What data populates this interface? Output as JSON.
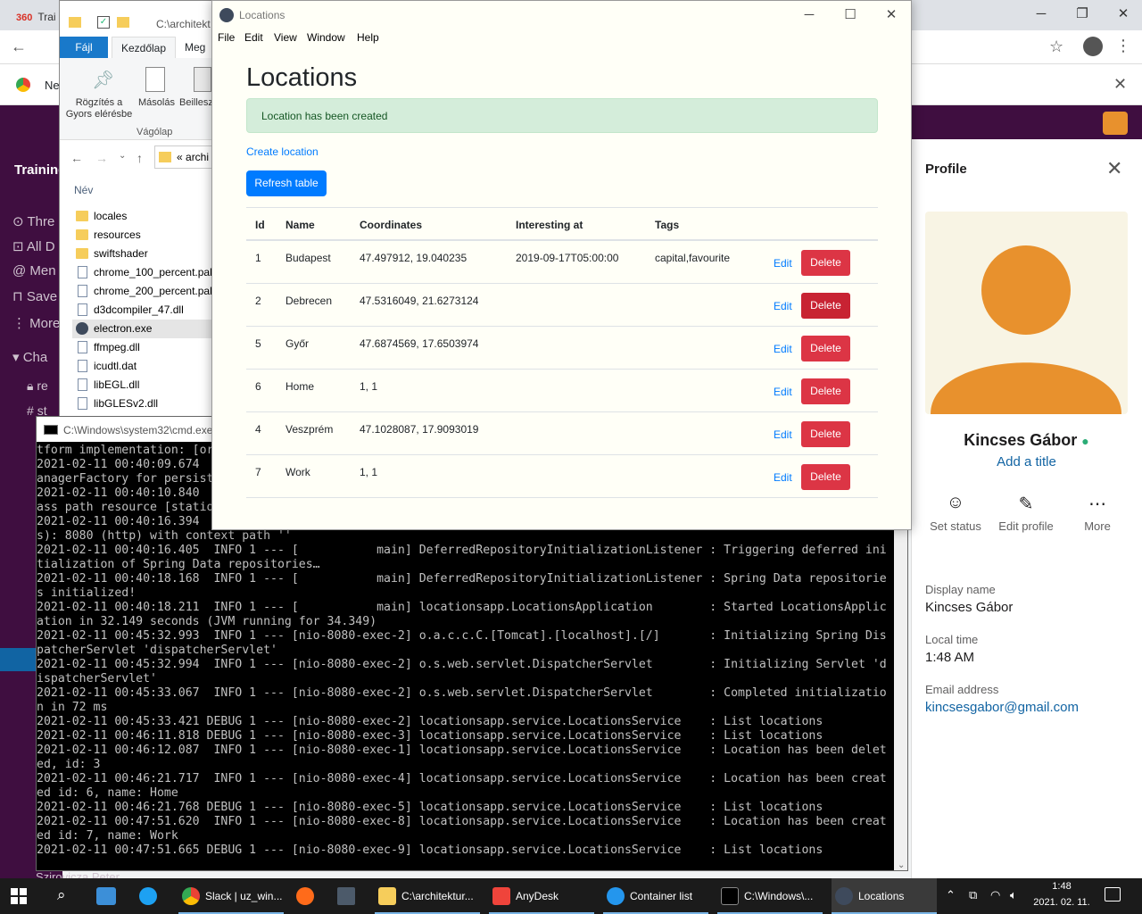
{
  "chrome": {
    "tab_title": "Trai",
    "tab_logo": "360",
    "bookmark_text": "Ne"
  },
  "slack": {
    "workspace": "Training",
    "nav": [
      "Thre",
      "All D",
      "Men",
      "Save",
      "More",
      "Cha"
    ],
    "channel_prefix_1": "re",
    "channel_prefix_2": "st",
    "bottom_user": "Szirovicza Peter",
    "profile": {
      "title": "Profile",
      "name": "Kincses Gábor",
      "add_title": "Add a title",
      "actions": [
        "Set status",
        "Edit profile",
        "More"
      ],
      "display_name_label": "Display name",
      "display_name": "Kincses Gábor",
      "local_time_label": "Local time",
      "local_time": "1:48 AM",
      "email_label": "Email address",
      "email": "kincsesgabor@gmail.com"
    }
  },
  "explorer": {
    "title": "C:\\architekt",
    "tabs": {
      "file": "Fájl",
      "home": "Kezdőlap",
      "share": "Meg"
    },
    "ribbon": {
      "pin": "Rögzítés a Gyors elérésbe",
      "copy": "Másolás",
      "paste": "Beillesz",
      "group": "Vágólap"
    },
    "address": "archi",
    "column": "Név",
    "files": [
      {
        "name": "locales",
        "type": "folder"
      },
      {
        "name": "resources",
        "type": "folder"
      },
      {
        "name": "swiftshader",
        "type": "folder"
      },
      {
        "name": "chrome_100_percent.pak",
        "type": "doc"
      },
      {
        "name": "chrome_200_percent.pak",
        "type": "doc"
      },
      {
        "name": "d3dcompiler_47.dll",
        "type": "doc"
      },
      {
        "name": "electron.exe",
        "type": "exe",
        "selected": true
      },
      {
        "name": "ffmpeg.dll",
        "type": "doc"
      },
      {
        "name": "icudtl.dat",
        "type": "doc"
      },
      {
        "name": "libEGL.dll",
        "type": "doc"
      },
      {
        "name": "libGLESv2.dll",
        "type": "doc"
      }
    ]
  },
  "cmd": {
    "title": "C:\\Windows\\system32\\cmd.exe",
    "lines": [
      "tform implementation: [or",
      "2021-02-11 00:40:09.674",
      "anagerFactory for persist",
      "2021-02-11 00:40:10.840",
      "ass path resource [statio",
      "2021-02-11 00:40:16.394",
      "s): 8080 (http) with context path ''",
      "2021-02-11 00:40:16.405  INFO 1 --- [           main] DeferredRepositoryInitializationListener : Triggering deferred ini",
      "tialization of Spring Data repositories…",
      "2021-02-11 00:40:18.168  INFO 1 --- [           main] DeferredRepositoryInitializationListener : Spring Data repositorie",
      "s initialized!",
      "2021-02-11 00:40:18.211  INFO 1 --- [           main] locationsapp.LocationsApplication        : Started LocationsApplic",
      "ation in 32.149 seconds (JVM running for 34.349)",
      "2021-02-11 00:45:32.993  INFO 1 --- [nio-8080-exec-2] o.a.c.c.C.[Tomcat].[localhost].[/]       : Initializing Spring Dis",
      "patcherServlet 'dispatcherServlet'",
      "2021-02-11 00:45:32.994  INFO 1 --- [nio-8080-exec-2] o.s.web.servlet.DispatcherServlet        : Initializing Servlet 'd",
      "ispatcherServlet'",
      "2021-02-11 00:45:33.067  INFO 1 --- [nio-8080-exec-2] o.s.web.servlet.DispatcherServlet        : Completed initializatio",
      "n in 72 ms",
      "2021-02-11 00:45:33.421 DEBUG 1 --- [nio-8080-exec-2] locationsapp.service.LocationsService    : List locations",
      "2021-02-11 00:46:11.818 DEBUG 1 --- [nio-8080-exec-3] locationsapp.service.LocationsService    : List locations",
      "2021-02-11 00:46:12.087  INFO 1 --- [nio-8080-exec-1] locationsapp.service.LocationsService    : Location has been delet",
      "ed, id: 3",
      "2021-02-11 00:46:21.717  INFO 1 --- [nio-8080-exec-4] locationsapp.service.LocationsService    : Location has been creat",
      "ed id: 6, name: Home",
      "2021-02-11 00:46:21.768 DEBUG 1 --- [nio-8080-exec-5] locationsapp.service.LocationsService    : List locations",
      "2021-02-11 00:47:51.620  INFO 1 --- [nio-8080-exec-8] locationsapp.service.LocationsService    : Location has been creat",
      "ed id: 7, name: Work",
      "2021-02-11 00:47:51.665 DEBUG 1 --- [nio-8080-exec-9] locationsapp.service.LocationsService    : List locations"
    ]
  },
  "locations_app": {
    "window_title": "Locations",
    "menu": [
      "File",
      "Edit",
      "View",
      "Window",
      "Help"
    ],
    "heading": "Locations",
    "alert": "Location has been created",
    "create_link": "Create location",
    "refresh_button": "Refresh table",
    "columns": [
      "Id",
      "Name",
      "Coordinates",
      "Interesting at",
      "Tags"
    ],
    "edit_label": "Edit",
    "delete_label": "Delete",
    "rows": [
      {
        "id": "1",
        "name": "Budapest",
        "coords": "47.497912, 19.040235",
        "interesting_at": "2019-09-17T05:00:00",
        "tags": "capital,favourite"
      },
      {
        "id": "2",
        "name": "Debrecen",
        "coords": "47.5316049, 21.6273124",
        "interesting_at": "",
        "tags": ""
      },
      {
        "id": "5",
        "name": "Győr",
        "coords": "47.6874569, 17.6503974",
        "interesting_at": "",
        "tags": ""
      },
      {
        "id": "6",
        "name": "Home",
        "coords": "1, 1",
        "interesting_at": "",
        "tags": ""
      },
      {
        "id": "4",
        "name": "Veszprém",
        "coords": "47.1028087, 17.9093019",
        "interesting_at": "",
        "tags": ""
      },
      {
        "id": "7",
        "name": "Work",
        "coords": "1, 1",
        "interesting_at": "",
        "tags": ""
      }
    ]
  },
  "taskbar": {
    "items": [
      {
        "label": "Slack | uz_win...",
        "color": "#e8912d"
      },
      {
        "label": "C:\\architektur...",
        "color": "#f6cd5b"
      },
      {
        "label": "AnyDesk",
        "color": "#ef443b"
      },
      {
        "label": "Container list",
        "color": "#2496ed"
      },
      {
        "label": "C:\\Windows\\...",
        "color": "#333333"
      },
      {
        "label": "Locations",
        "color": "#3e4a5c"
      }
    ],
    "time": "1:48",
    "date": "2021. 02. 11."
  }
}
